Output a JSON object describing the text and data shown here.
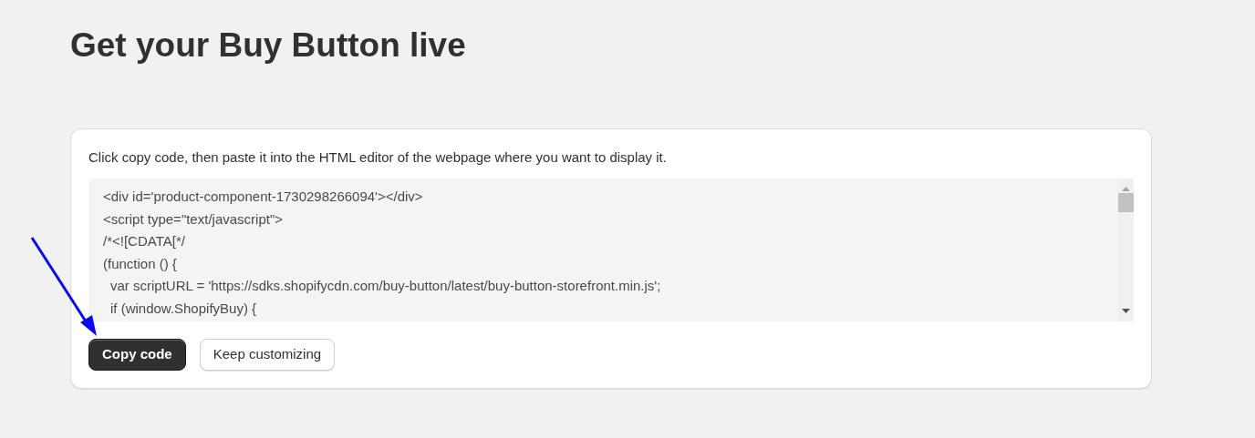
{
  "page_title": "Get your Buy Button live",
  "card": {
    "instructions": "Click copy code, then paste it into the HTML editor of the webpage where you want to display it.",
    "code_lines": [
      {
        "text": "<div id='product-component-1730298266094'></div>",
        "indent": false
      },
      {
        "text": "<script type=\"text/javascript\">",
        "indent": false
      },
      {
        "text": "/*<![CDATA[*/",
        "indent": false
      },
      {
        "text": "(function () {",
        "indent": false
      },
      {
        "text": "var scriptURL = 'https://sdks.shopifycdn.com/buy-button/latest/buy-button-storefront.min.js';",
        "indent": true
      },
      {
        "text": "if (window.ShopifyBuy) {",
        "indent": true
      }
    ],
    "buttons": [
      {
        "label": "Copy code",
        "kind": "primary"
      },
      {
        "label": "Keep customizing",
        "kind": "secondary"
      }
    ]
  }
}
